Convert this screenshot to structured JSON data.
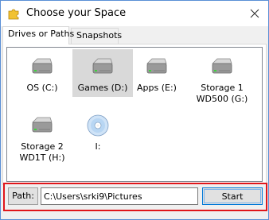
{
  "window": {
    "title": "Choose your Space",
    "app_icon": "puzzle-piece-icon",
    "close_icon": "close-icon"
  },
  "tabs": [
    {
      "label": "Drives or Paths",
      "active": true
    },
    {
      "label": "Snapshots",
      "active": false
    }
  ],
  "drives": [
    {
      "label": "OS (C:)",
      "icon": "hard-drive-icon",
      "selected": false
    },
    {
      "label": "Games (D:)",
      "icon": "hard-drive-icon",
      "selected": true
    },
    {
      "label": "Apps (E:)",
      "icon": "hard-drive-icon",
      "selected": false
    },
    {
      "label": "Storage 1 WD500 (G:)",
      "icon": "hard-drive-icon",
      "selected": false
    },
    {
      "label": "Storage 2 WD1T (H:)",
      "icon": "hard-drive-icon",
      "selected": false
    },
    {
      "label": "I:",
      "icon": "optical-disc-icon",
      "selected": false
    }
  ],
  "path_bar": {
    "label": "Path:",
    "value": "C:\\Users\\srki9\\Pictures",
    "start_label": "Start",
    "highlight_color": "#e0161b"
  }
}
